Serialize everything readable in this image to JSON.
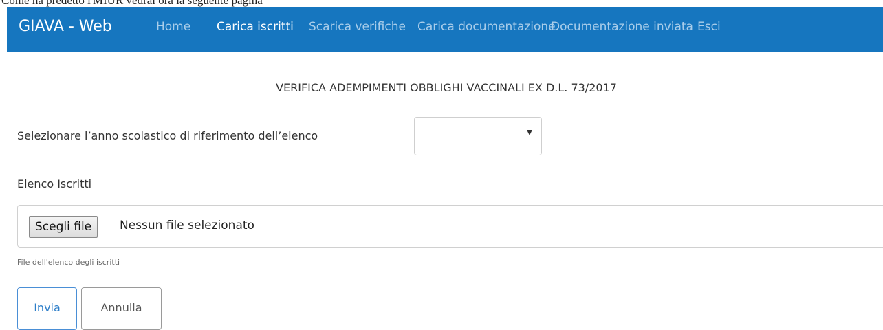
{
  "top_strip": {
    "text": "Come ha predetto l'MIUR vedrai ora la seguente pagina"
  },
  "navbar": {
    "brand": "GIAVA - Web",
    "items": [
      {
        "label": "Home",
        "active": false
      },
      {
        "label": "Carica iscritti",
        "active": true
      },
      {
        "label": "Scarica verifiche",
        "active": false
      },
      {
        "label": "Carica documentazione",
        "active": false
      },
      {
        "label": "Documentazione inviata",
        "active": false
      },
      {
        "label": "Esci",
        "active": false
      }
    ],
    "colors": {
      "background": "#1676bf",
      "active_text": "#ffffff",
      "inactive_text": "#a9cdea"
    }
  },
  "form": {
    "heading": "VERIFICA ADEMPIMENTI OBBLIGHI VACCINALI EX D.L. 73/2017",
    "year_label": "Selezionare l’anno scolastico di riferimento dell’elenco",
    "year_select": {
      "selected_value": "",
      "arrow_icon": "dropdown-triangle-icon"
    },
    "list_label": "Elenco Iscritti",
    "file_input": {
      "button_label": "Scegli file",
      "status": "Nessun file selezionato"
    },
    "help_text": "File dell'elenco degli iscritti",
    "buttons": {
      "submit": "Invia",
      "cancel": "Annulla"
    }
  }
}
